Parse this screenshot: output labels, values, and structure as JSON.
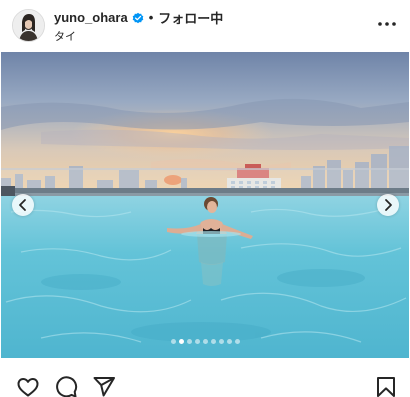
{
  "post": {
    "username": "yuno_ohara",
    "separator": "•",
    "follow_label": "フォロー中",
    "location": "タイ",
    "verified": true,
    "carousel": {
      "total_slides": 9,
      "current_slide": 2
    },
    "icons": {
      "avatar": "avatar",
      "verified": "verified-badge-icon",
      "more": "more-options-icon",
      "prev": "chevron-left-icon",
      "next": "chevron-right-icon",
      "like": "heart-icon",
      "comment": "comment-icon",
      "share": "paper-plane-icon",
      "save": "bookmark-icon"
    },
    "colors": {
      "verified_blue": "#0095f6",
      "text": "#262626",
      "pool_water": "#5ec4d6",
      "sky_top": "#7f93b3",
      "sky_horizon": "#f2cda3"
    }
  }
}
